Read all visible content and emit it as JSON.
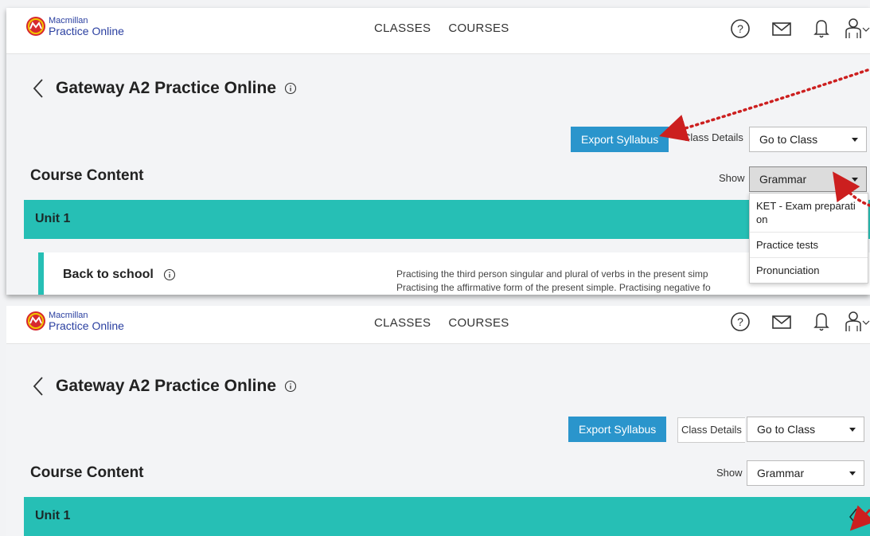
{
  "brand": {
    "line1": "Macmillan",
    "line2": "Practice Online"
  },
  "nav": {
    "classes": "CLASSES",
    "courses": "COURSES"
  },
  "icons": {
    "help": "help-circle-icon",
    "mail": "mail-icon",
    "bell": "bell-icon",
    "user": "user-icon",
    "back": "chevron-left-icon",
    "info": "info-icon"
  },
  "course": {
    "title": "Gateway A2 Practice Online"
  },
  "toolbar": {
    "export_label": "Export Syllabus",
    "class_details_label": "Class Details",
    "goto_value": "Go to Class",
    "show_label": "Show",
    "show_value": "Grammar"
  },
  "content": {
    "section_title": "Course Content",
    "unit_title": "Unit 1",
    "lesson_title": "Back to school",
    "lesson_desc_line1": "Practising the third person singular and plural of verbs in the present simp",
    "lesson_desc_line2": "Practising the affirmative form of the present simple. Practising negative fo"
  },
  "dropdown": {
    "items": [
      "KET - Exam preparati on",
      "Practice tests",
      "Pronunciation"
    ]
  },
  "colors": {
    "accent": "#26bfb5",
    "button": "#2a95cc",
    "annotation": "#cc1f1f"
  }
}
